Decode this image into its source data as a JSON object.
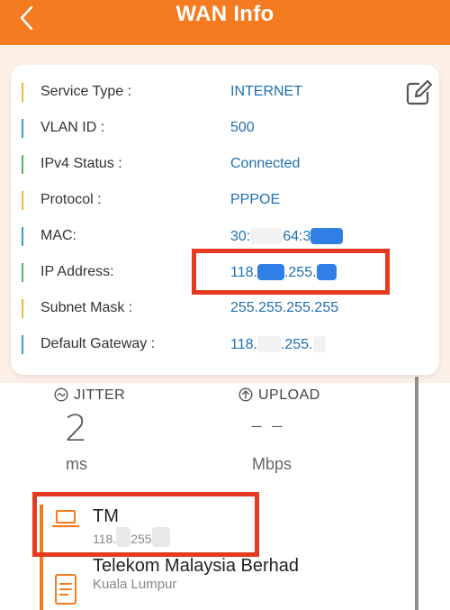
{
  "header": {
    "title": "WAN Info",
    "back_icon": "chevron-left-icon"
  },
  "wan": {
    "rows": [
      {
        "label": "Service Type :",
        "value": "INTERNET",
        "bar_color": "#f2b233"
      },
      {
        "label": "VLAN ID :",
        "value": "500",
        "bar_color": "#3aa0c9"
      },
      {
        "label": "IPv4 Status :",
        "value": "Connected",
        "bar_color": "#5ab55e"
      },
      {
        "label": "Protocol :",
        "value": "PPPOE",
        "bar_color": "#f2b233"
      },
      {
        "label": "MAC:",
        "value_a": "30:",
        "value_b": "64:3",
        "bar_color": "#3aa0c9"
      },
      {
        "label": "IP Address:",
        "value_a": "118.",
        "value_b": ".255.",
        "bar_color": "#5ab55e"
      },
      {
        "label": "Subnet Mask :",
        "value": "255.255.255.255",
        "bar_color": "#f2b233"
      },
      {
        "label": "Default Gateway :",
        "value_a": "118.",
        "value_b": ".255.",
        "bar_color": "#3aa0c9"
      }
    ],
    "edit_icon": "edit-icon"
  },
  "metrics": {
    "jitter": {
      "label": "JITTER",
      "value": "2",
      "unit": "ms",
      "icon": "jitter-icon"
    },
    "upload": {
      "label": "UPLOAD",
      "value": "– –",
      "unit": "Mbps",
      "icon": "upload-icon"
    }
  },
  "isp": {
    "name": "TM",
    "ip_a": "118.",
    "ip_b": "255",
    "org": "Telekom Malaysia Berhad",
    "location": "Kuala Lumpur",
    "device_icon": "laptop-icon",
    "server_icon": "server-icon"
  },
  "colors": {
    "accent": "#f47b20",
    "link": "#1f6fb2",
    "highlight_box": "#e53a1f"
  }
}
